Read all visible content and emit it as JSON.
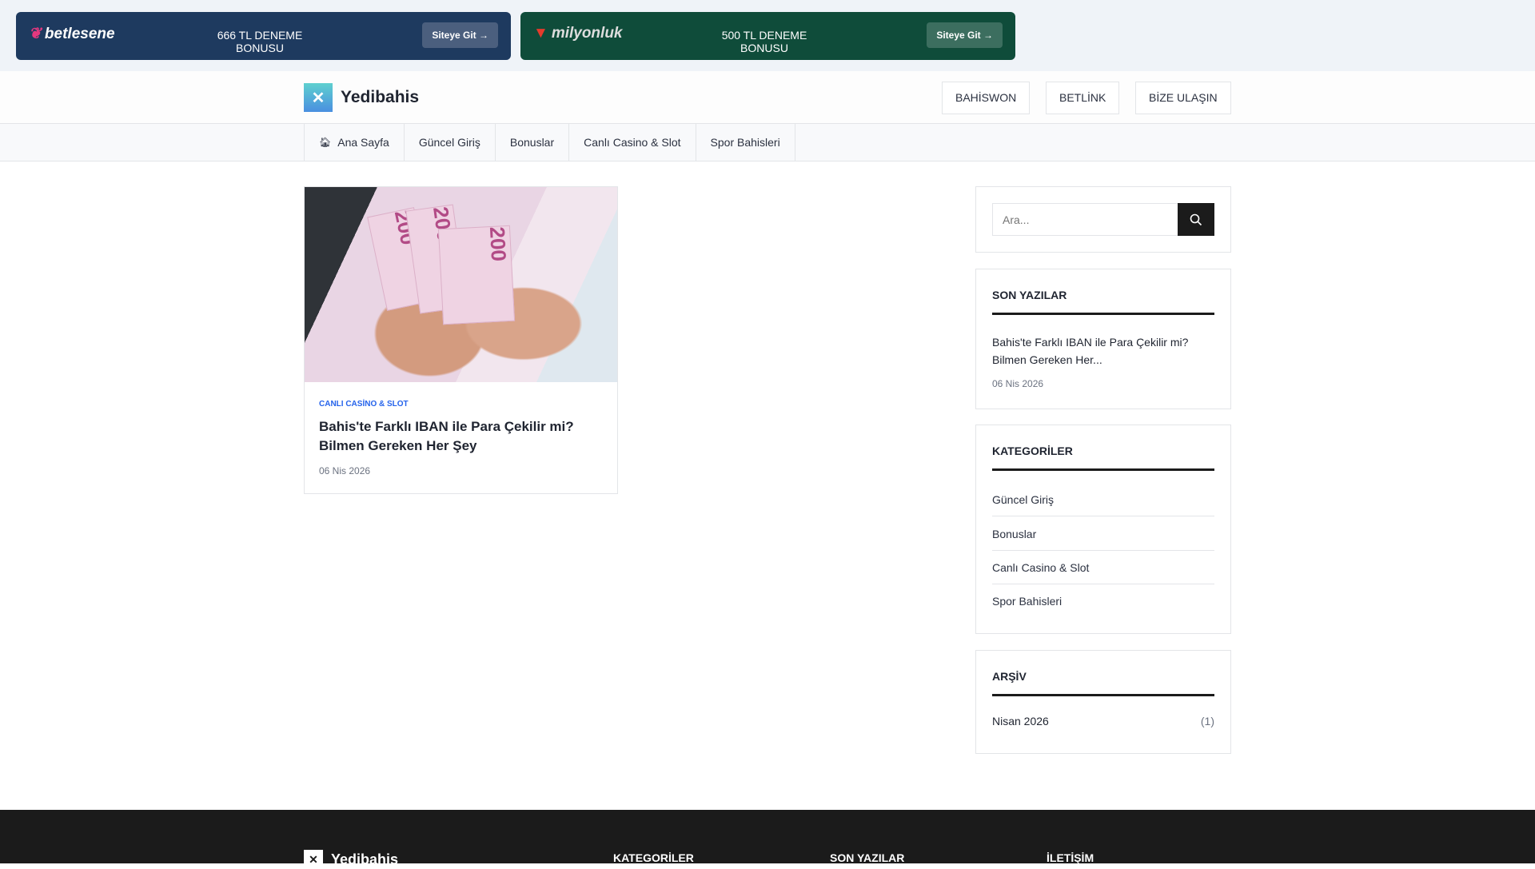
{
  "banners": [
    {
      "brand": "betlesene",
      "text": "666 TL DENEME BONUSU",
      "button": "Siteye Git →",
      "color": "#1e3a5f",
      "button_color": "#4b5f7e"
    },
    {
      "brand": "milyonluk",
      "text": "500 TL DENEME BONUSU",
      "button": "Siteye Git →",
      "color": "#0f4c3a",
      "button_color": "#3c6e5f"
    }
  ],
  "header": {
    "site_name": "Yedibahis",
    "buttons": [
      "BAHİSWON",
      "BETLİNK",
      "BİZE ULAŞIN"
    ]
  },
  "nav": {
    "items": [
      "Ana Sayfa",
      "Güncel Giriş",
      "Bonuslar",
      "Canlı Casino & Slot",
      "Spor Bahisleri"
    ]
  },
  "post": {
    "category": "CANLI CASİNO & SLOT",
    "title": "Bahis'te Farklı IBAN ile Para Çekilir mi? Bilmen Gereken Her Şey",
    "date": "06 Nis 2026",
    "image_notes": [
      "200",
      "200",
      "200"
    ]
  },
  "sidebar": {
    "search_placeholder": "Ara...",
    "recent": {
      "title": "SON YAZILAR",
      "items": [
        {
          "title": "Bahis'te Farklı IBAN ile Para Çekilir mi? Bilmen Gereken Her...",
          "date": "06 Nis 2026"
        }
      ]
    },
    "categories": {
      "title": "KATEGORİLER",
      "items": [
        "Güncel Giriş",
        "Bonuslar",
        "Canlı Casino & Slot",
        "Spor Bahisleri"
      ]
    },
    "archive": {
      "title": "ARŞİV",
      "items": [
        {
          "label": "Nisan 2026",
          "count": "(1)"
        }
      ]
    }
  },
  "footer": {
    "site_name": "Yedibahis",
    "columns": [
      "KATEGORİLER",
      "SON YAZILAR",
      "İLETİŞİM"
    ]
  }
}
